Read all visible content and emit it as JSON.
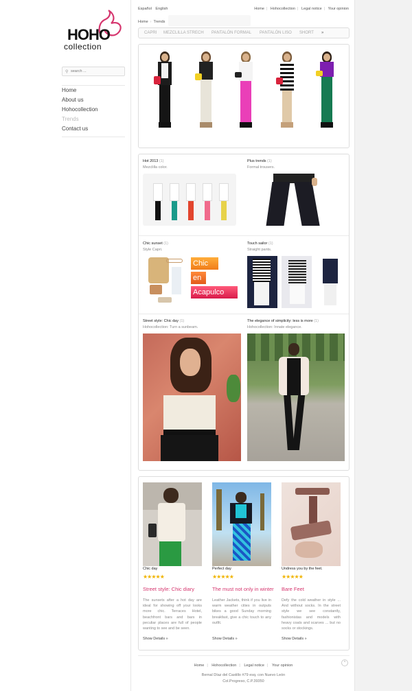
{
  "brand": {
    "logo_main": "HOHO",
    "logo_sub": "collection"
  },
  "search": {
    "placeholder": "search ..."
  },
  "sidebar": {
    "items": [
      {
        "label": "Home"
      },
      {
        "label": "About us"
      },
      {
        "label": "Hohocollection"
      },
      {
        "label": "Trends"
      },
      {
        "label": "Contact us"
      }
    ]
  },
  "header": {
    "languages": [
      "Español",
      "English"
    ],
    "links": [
      "Home",
      "Hohocollection",
      "Legal notice",
      "Your opinion"
    ]
  },
  "breadcrumb": {
    "home": "Home",
    "current": "Trends"
  },
  "tabs": [
    "CAPRI",
    "MEZCLILLA STRECH",
    "PANTALÓN FORMAL",
    "PANTALÓN LISO",
    "SHORT",
    "»"
  ],
  "grid": [
    {
      "title": "Hot 2013",
      "count": "(1)",
      "subtitle": "Mezclilla color."
    },
    {
      "title": "Plus trends",
      "count": "(1)",
      "subtitle": "Formal trousers."
    },
    {
      "title": "Chic sunset",
      "count": "(1)",
      "subtitle": "Style Capri."
    },
    {
      "title": "Touch sailor",
      "count": "(1)",
      "subtitle": "Straight pants."
    },
    {
      "title": "Street style: Chic day",
      "count": "(1)",
      "subtitle": "Hohocollection: Turn a sunbeam."
    },
    {
      "title": "The elegance of simplicity: less is more",
      "count": "(1)",
      "subtitle": "Hohocollection: Innate elegance."
    }
  ],
  "promo_text": [
    "Chic",
    "en",
    "Acapulco"
  ],
  "cards": [
    {
      "title": "Chic day",
      "stars": "★★★★★",
      "heading": "Street style: Chic diary",
      "text": "The sunsets after a hot day are ideal for showing off your looks more chic. Terraces Hotel, beachfront bars and bars in peculiar places are full of people wanting to see and be seen.",
      "more": "Show Details »"
    },
    {
      "title": "Perfect day",
      "stars": "★★★★★",
      "heading": "The must not only in winter",
      "text": "Leather Jackets, think if you live in warm weather cities in outputs bikes a good Sunday morning breakfast, give a chic touch to any outfit.",
      "more": "Show Details »"
    },
    {
      "title": "Undress you by the feet.",
      "stars": "★★★★★",
      "heading": "Bare Feet",
      "text": "Defy the cold weather in style ... And without socks. In the street style we see constantly, fashionistas and models with heavy coats and scarves ... but no socks or stockings.",
      "more": "Show Details »"
    }
  ],
  "footer": {
    "links": [
      "Home",
      "Hohocollection",
      "Legal notice",
      "Your opinion"
    ],
    "address_line1": "Bernal Díaz del Castillo #79 esq. con Nuevo León",
    "address_line2": "Col.Progreso, C.P.39350",
    "to_top": "^"
  },
  "colors": {
    "accent": "#d6376f",
    "stars": "#f0b400",
    "border": "#dddddd"
  }
}
